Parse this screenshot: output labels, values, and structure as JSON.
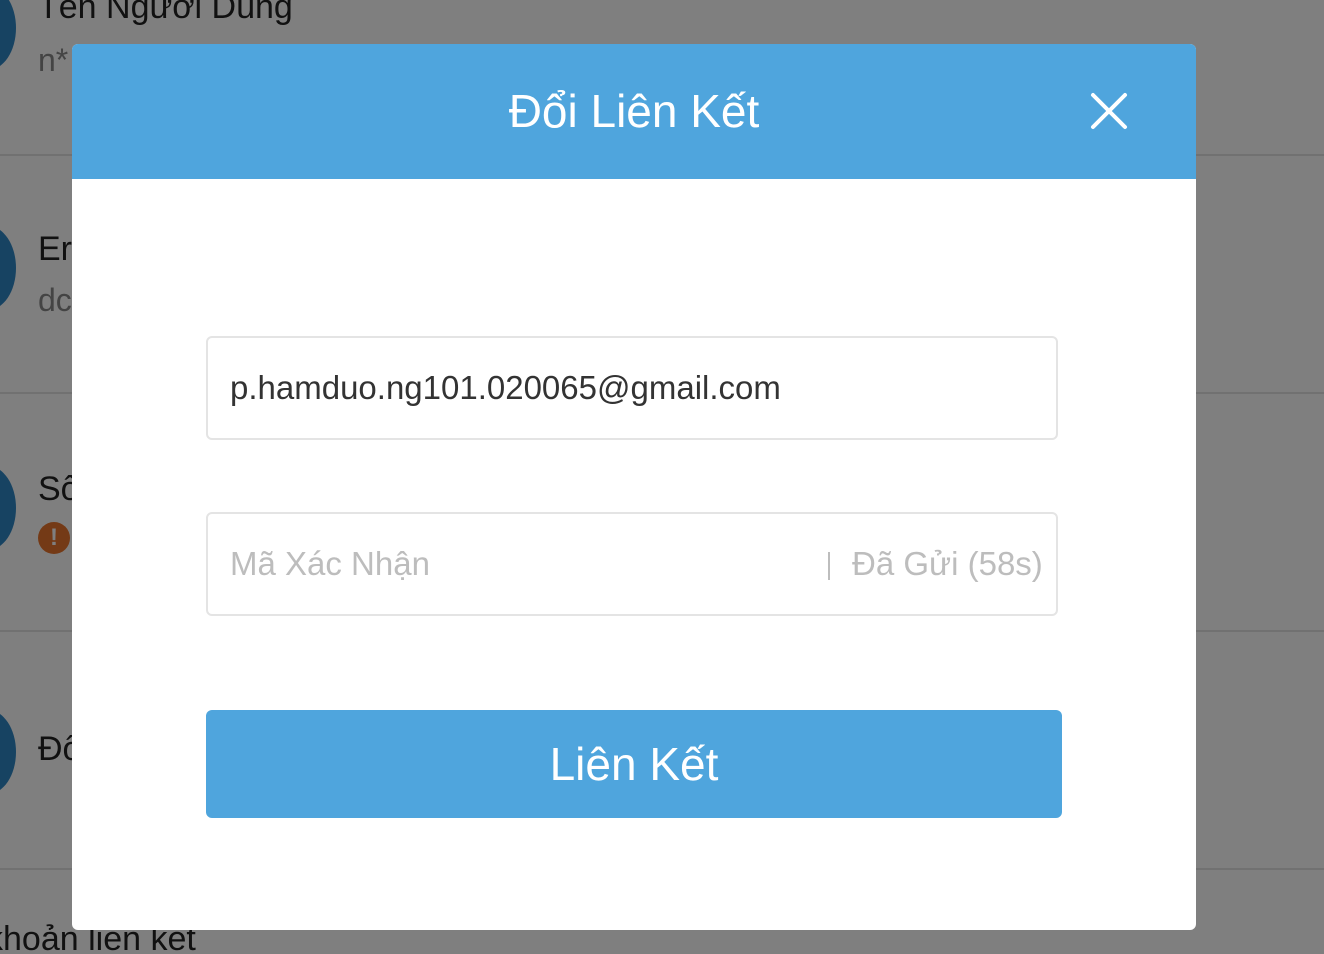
{
  "background": {
    "rows": [
      {
        "title": "Tên Người Dùng",
        "sub": "n*"
      },
      {
        "title": "Er",
        "sub": "dc"
      },
      {
        "title": "Số",
        "sub": ""
      },
      {
        "title": "Đổ",
        "sub": ""
      }
    ],
    "footer": "khoản liên kết"
  },
  "modal": {
    "title": "Đổi Liên Kết",
    "email_value": "p.hamduo.ng101.020065@gmail.com",
    "code_placeholder": "Mã Xác Nhận",
    "resend_label": "Đã Gửi (58s)",
    "submit_label": "Liên Kết"
  },
  "colors": {
    "accent": "#4fa5dd",
    "overlay": "rgba(0,0,0,0.5)",
    "warning": "#e8742c"
  },
  "icons": {
    "close": "close-icon",
    "warning": "warning-icon"
  }
}
